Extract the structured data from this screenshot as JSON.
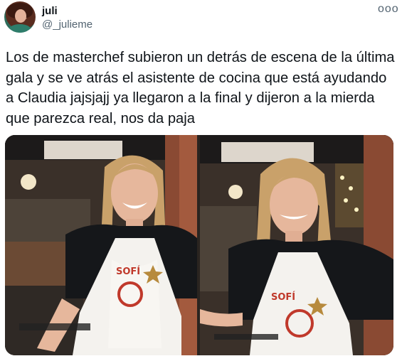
{
  "tweet": {
    "display_name": "juli",
    "handle": "@_julieme",
    "more_label": "ooo",
    "text": "Los de masterchef subieron un detrás de escena de la última gala y se ve atrás el asistente de cocina que está ayudando a Claudia jajsjajj ya llegaron a la final y dijeron a la mierda que parezca real, nos da paja"
  },
  "media": {
    "apron_name": "SOFÍ"
  },
  "icons": {
    "avatar": "profile-avatar",
    "more": "more-options-icon"
  },
  "colors": {
    "text": "#0f1419",
    "secondary_text": "#536471",
    "apron_logo": "#c0392b"
  }
}
